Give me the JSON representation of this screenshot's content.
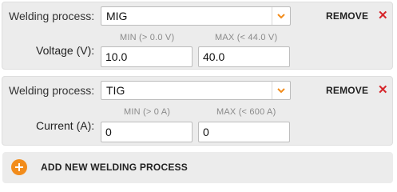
{
  "processes": [
    {
      "label": "Welding process:",
      "selected": "MIG",
      "remove": "REMOVE",
      "min_header": "MIN (> 0.0 V)",
      "max_header": "MAX (< 44.0 V)",
      "param_label": "Voltage (V):",
      "min_value": "10.0",
      "max_value": "40.0"
    },
    {
      "label": "Welding process:",
      "selected": "TIG",
      "remove": "REMOVE",
      "min_header": "MIN (> 0 A)",
      "max_header": "MAX (< 600 A)",
      "param_label": "Current (A):",
      "min_value": "0",
      "max_value": "0"
    }
  ],
  "add_button": {
    "label": "ADD NEW WELDING PROCESS",
    "icon": "plus-circle-icon"
  },
  "colors": {
    "accent": "#f28c1b",
    "remove_x": "#d6252a",
    "panel_bg": "#ececec"
  }
}
